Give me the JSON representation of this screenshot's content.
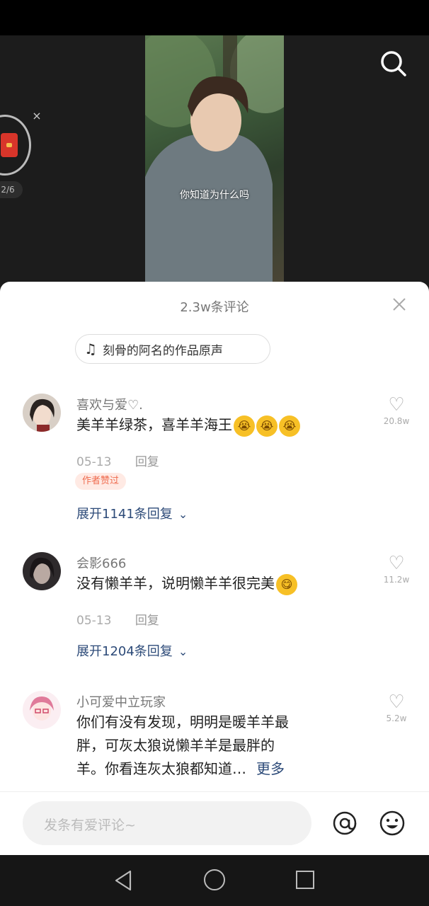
{
  "video": {
    "subtitle": "你知道为什么吗"
  },
  "redpacket": {
    "progress": "2/6",
    "close_symbol": "×"
  },
  "comments_sheet": {
    "title": "2.3w条评论",
    "music_label": "刻骨的阿名的作品原声",
    "music_icon": "music-note-icon",
    "input_placeholder": "发条有爱评论~"
  },
  "comments": [
    {
      "username": "喜欢与爱♡.",
      "text": "美羊羊绿茶，喜羊羊海王",
      "emojis": [
        "😭",
        "😭",
        "😭"
      ],
      "date": "05-13",
      "reply_label": "回复",
      "badge": "作者赞过",
      "expand_label": "展开1141条回复",
      "likes": "20.8w"
    },
    {
      "username": "会影666",
      "text": "没有懒羊羊，说明懒羊羊很完美",
      "emojis": [
        "😋"
      ],
      "date": "05-13",
      "reply_label": "回复",
      "expand_label": "展开1204条回复",
      "likes": "11.2w"
    },
    {
      "username": "小可爱中立玩家",
      "line1": "你们有没有发现，明明是暖羊羊最",
      "line2": "胖，可灰太狼说懒羊羊是最胖的",
      "line3": "羊。你看连灰太狼都知道…",
      "more_label": "更多",
      "likes": "5.2w"
    }
  ],
  "colors": {
    "link": "#2c4a78",
    "badge_text": "#ef6b4e",
    "badge_bg": "#ffeae4"
  }
}
